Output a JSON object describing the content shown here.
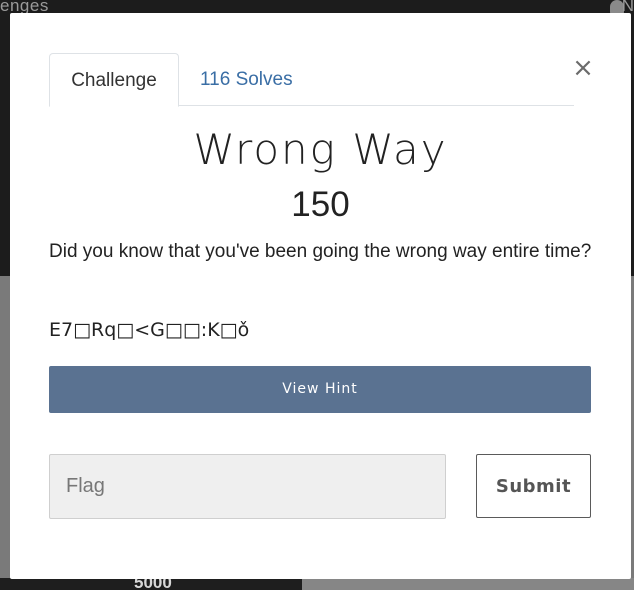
{
  "backdrop": {
    "nav_text": "enges",
    "nav_right_text": "N",
    "card_value": "5000"
  },
  "modal": {
    "tabs": [
      {
        "label": "Challenge"
      },
      {
        "label": "116 Solves"
      }
    ],
    "close_label": "×",
    "title": "Wrong Way",
    "points": "150",
    "description": "Did you know that you've been going the wrong way entire time?",
    "garbled_text": "E7□Rq□<G□□:K□ǒ",
    "hint_label": "View Hint",
    "flag_placeholder": "Flag",
    "flag_value": "",
    "submit_label": "Submit"
  },
  "colors": {
    "hint_button": "#5a7291",
    "link": "#3a6ea5"
  }
}
